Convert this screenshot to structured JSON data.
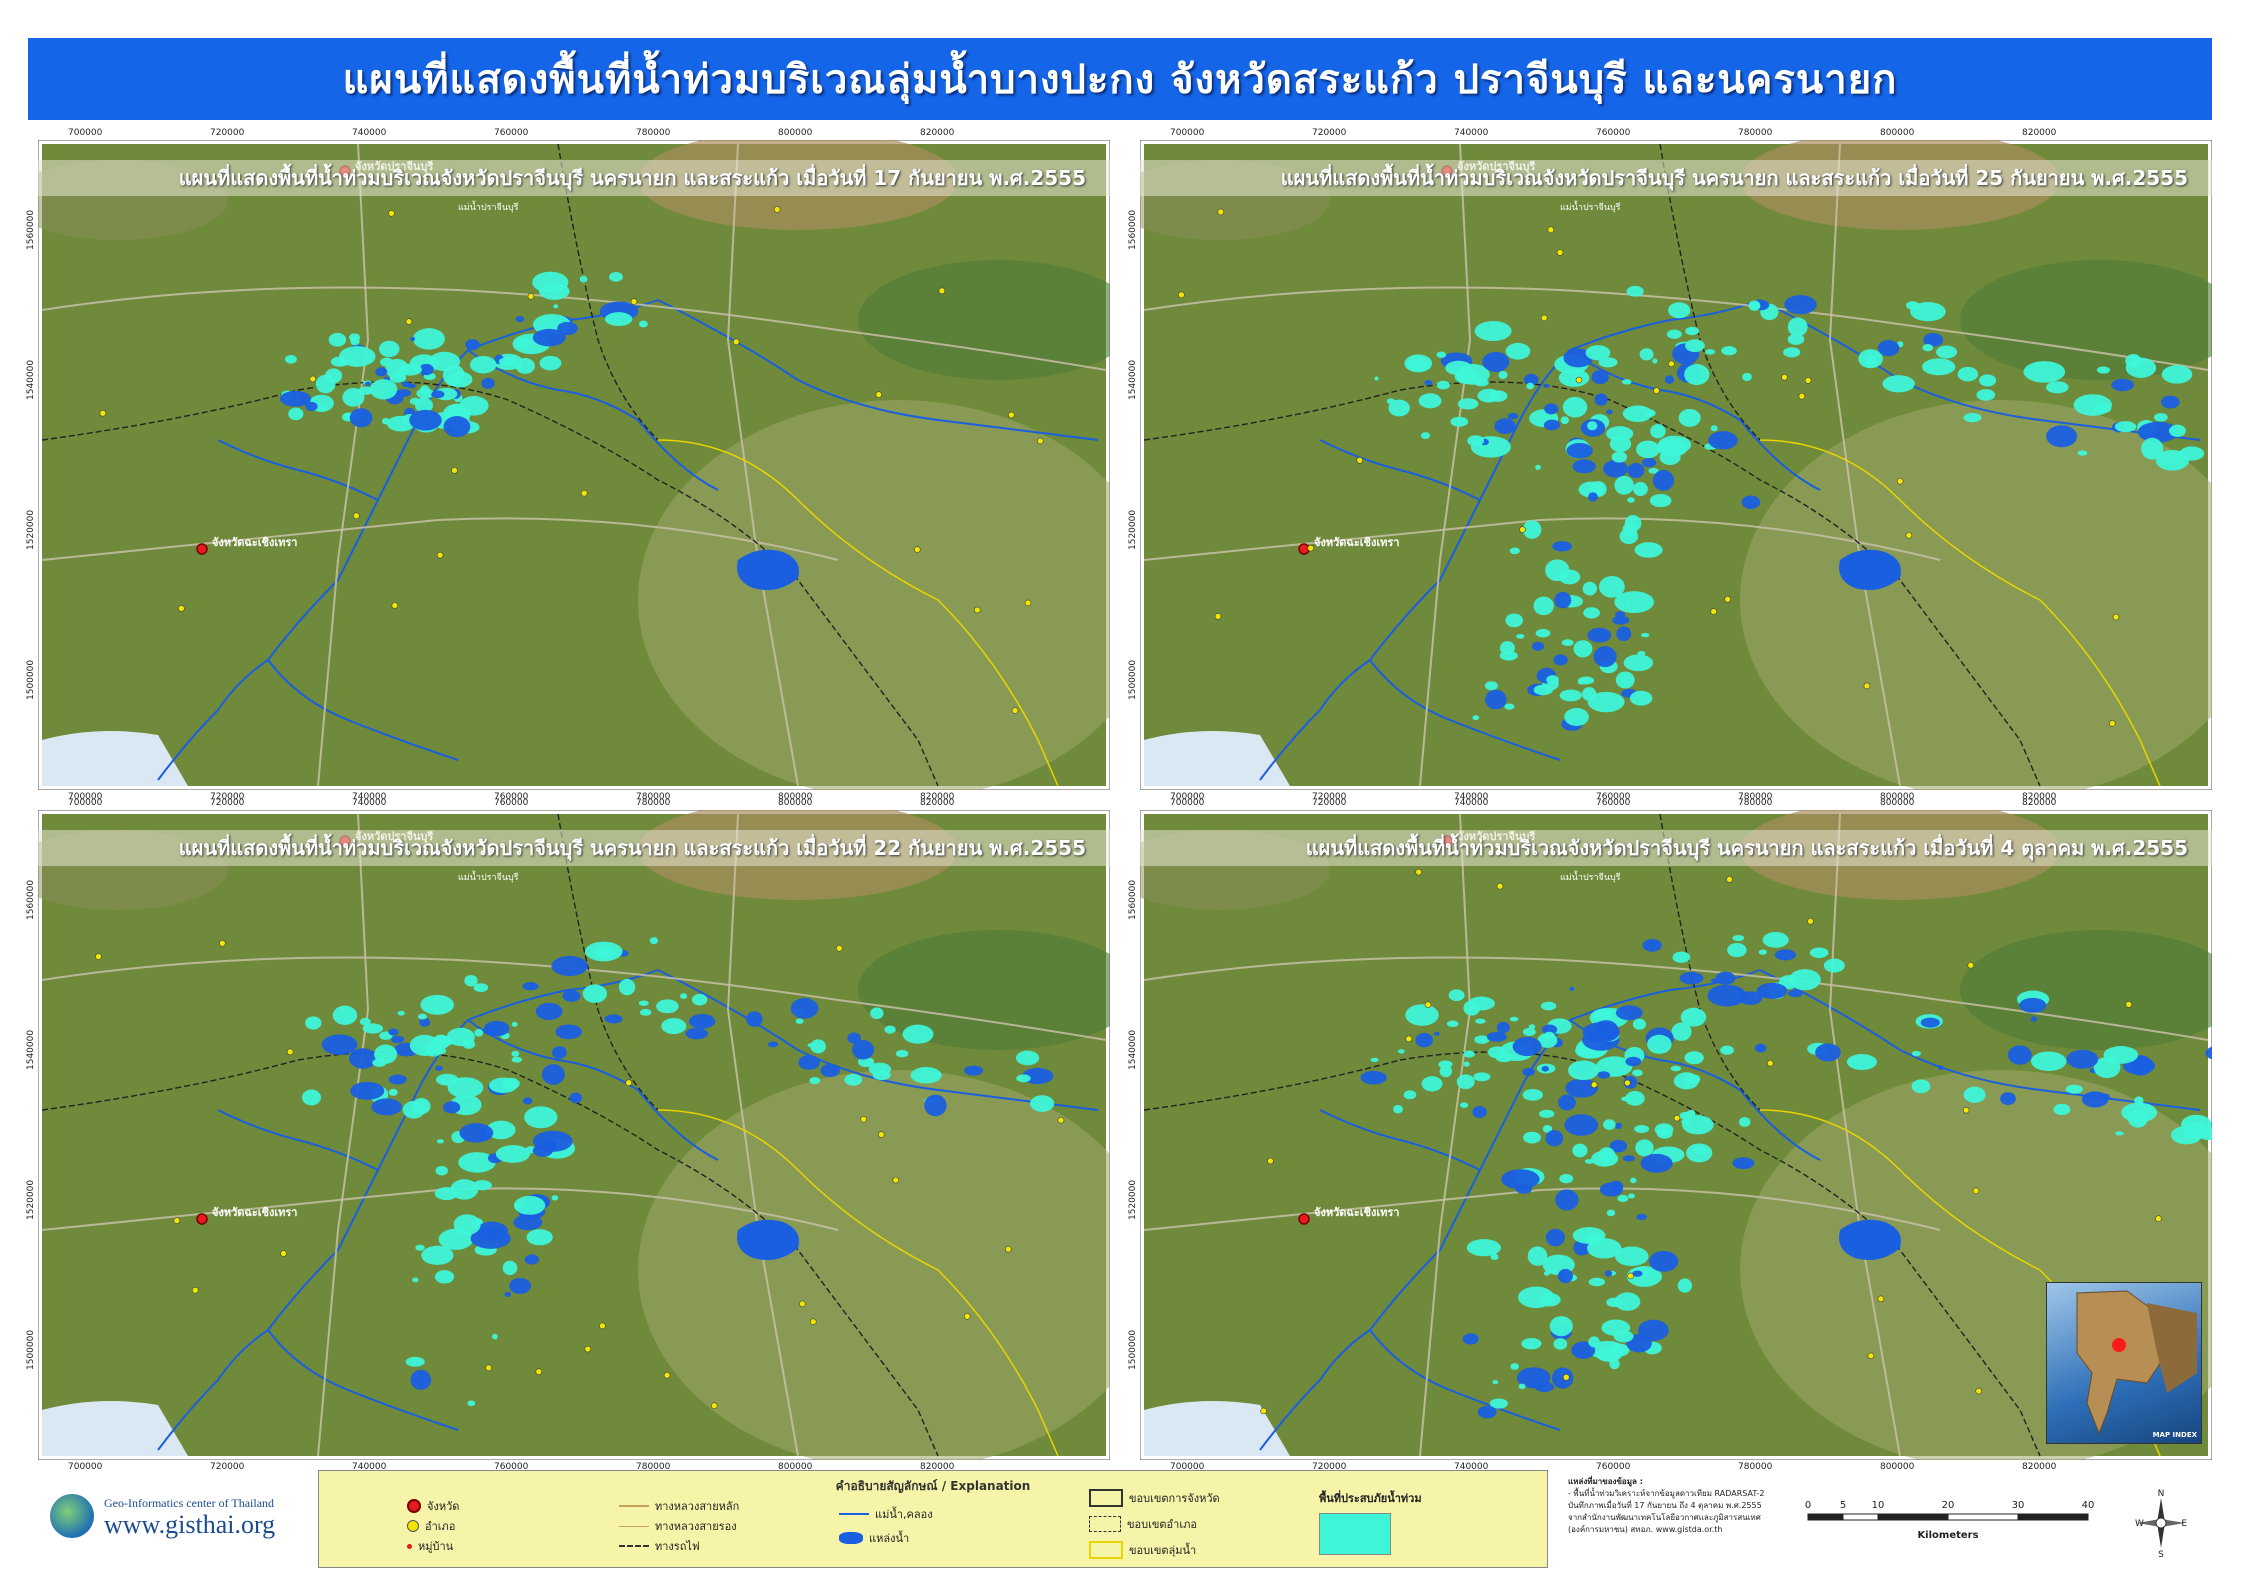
{
  "title": "แผนที่แสดงพื้นที่น้ำท่วมบริเวณลุ่มน้ำบางปะกง จังหวัดสระแก้ว ปราจีนบุรี และนครนายก",
  "panels": [
    {
      "caption": "แผนที่แสดงพื้นที่น้ำท่วมบริเวณจังหวัดปราจีนบุรี นครนายก และสระแก้ว เมื่อวันที่ 17 กันยายน พ.ศ.2555",
      "flood_level": 0.35
    },
    {
      "caption": "แผนที่แสดงพื้นที่น้ำท่วมบริเวณจังหวัดปราจีนบุรี นครนายก และสระแก้ว เมื่อวันที่ 25 กันยายน พ.ศ.2555",
      "flood_level": 0.75
    },
    {
      "caption": "แผนที่แสดงพื้นที่น้ำท่วมบริเวณจังหวัดปราจีนบุรี นครนายก และสระแก้ว เมื่อวันที่ 22 กันยายน พ.ศ.2555",
      "flood_level": 0.55
    },
    {
      "caption": "แผนที่แสดงพื้นที่น้ำท่วมบริเวณจังหวัดปราจีนบุรี นครนายก และสระแก้ว เมื่อวันที่ 4 ตุลาคม พ.ศ.2555",
      "flood_level": 0.85
    }
  ],
  "axis_ticks_x": [
    "700000",
    "720000",
    "740000",
    "760000",
    "780000",
    "800000",
    "820000"
  ],
  "axis_ticks_y": [
    "1560000",
    "1540000",
    "1520000",
    "1500000"
  ],
  "place_labels": {
    "prachinburi": "จังหวัดปราจีนบุรี",
    "chachoengsao": "จังหวัดฉะเชิงเทรา",
    "river": "แม่น้ำปราจีนบุรี"
  },
  "colors": {
    "title_bg": "#1565e8",
    "terrain": "#6f8a3a",
    "flood": "#3ef5d8",
    "water": "#1a5fe0",
    "legend_bg": "#f6f4a8"
  },
  "logo": {
    "org": "Geo-Informatics center of Thailand",
    "url": "www.gisthai.org"
  },
  "legend": {
    "title": "คำอธิบายสัญลักษณ์ / Explanation",
    "items": {
      "province": "จังหวัด",
      "district": "อำเภอ",
      "village": "หมู่บ้าน",
      "main_road": "ทางหลวงสายหลัก",
      "secondary_road": "ทางหลวงสายรอง",
      "railway": "ทางรถไฟ",
      "river": "แม่น้ำ,คลอง",
      "water_body": "แหล่งน้ำ",
      "province_boundary": "ขอบเขตการจังหวัด",
      "district_boundary": "ขอบเขตอำเภอ",
      "basin_boundary": "ขอบเขตลุ่มน้ำ",
      "flood_area": "พื้นที่ประสบภัยน้ำท่วม"
    }
  },
  "source": {
    "heading": "แหล่งที่มาของข้อมูล :",
    "line1": "- พื้นที่น้ำท่วมวิเคราะห์จากข้อมูลดาวเทียม RADARSAT-2",
    "line2": "บันทึกภาพเมื่อวันที่ 17 กันยายน ถึง 4 ตุลาคม พ.ศ.2555",
    "line3": "จากสำนักงานพัฒนาเทคโนโลยีอวกาศและภูมิสารสนเทศ",
    "line4": "(องค์การมหาชน) สทอภ. www.gistda.or.th"
  },
  "scale": {
    "labels": [
      "0",
      "5",
      "10",
      "20",
      "30",
      "40"
    ],
    "unit": "Kilometers"
  },
  "compass": {
    "n": "N",
    "s": "S",
    "e": "E",
    "w": "W"
  },
  "inset": {
    "label": "MAP INDEX"
  }
}
